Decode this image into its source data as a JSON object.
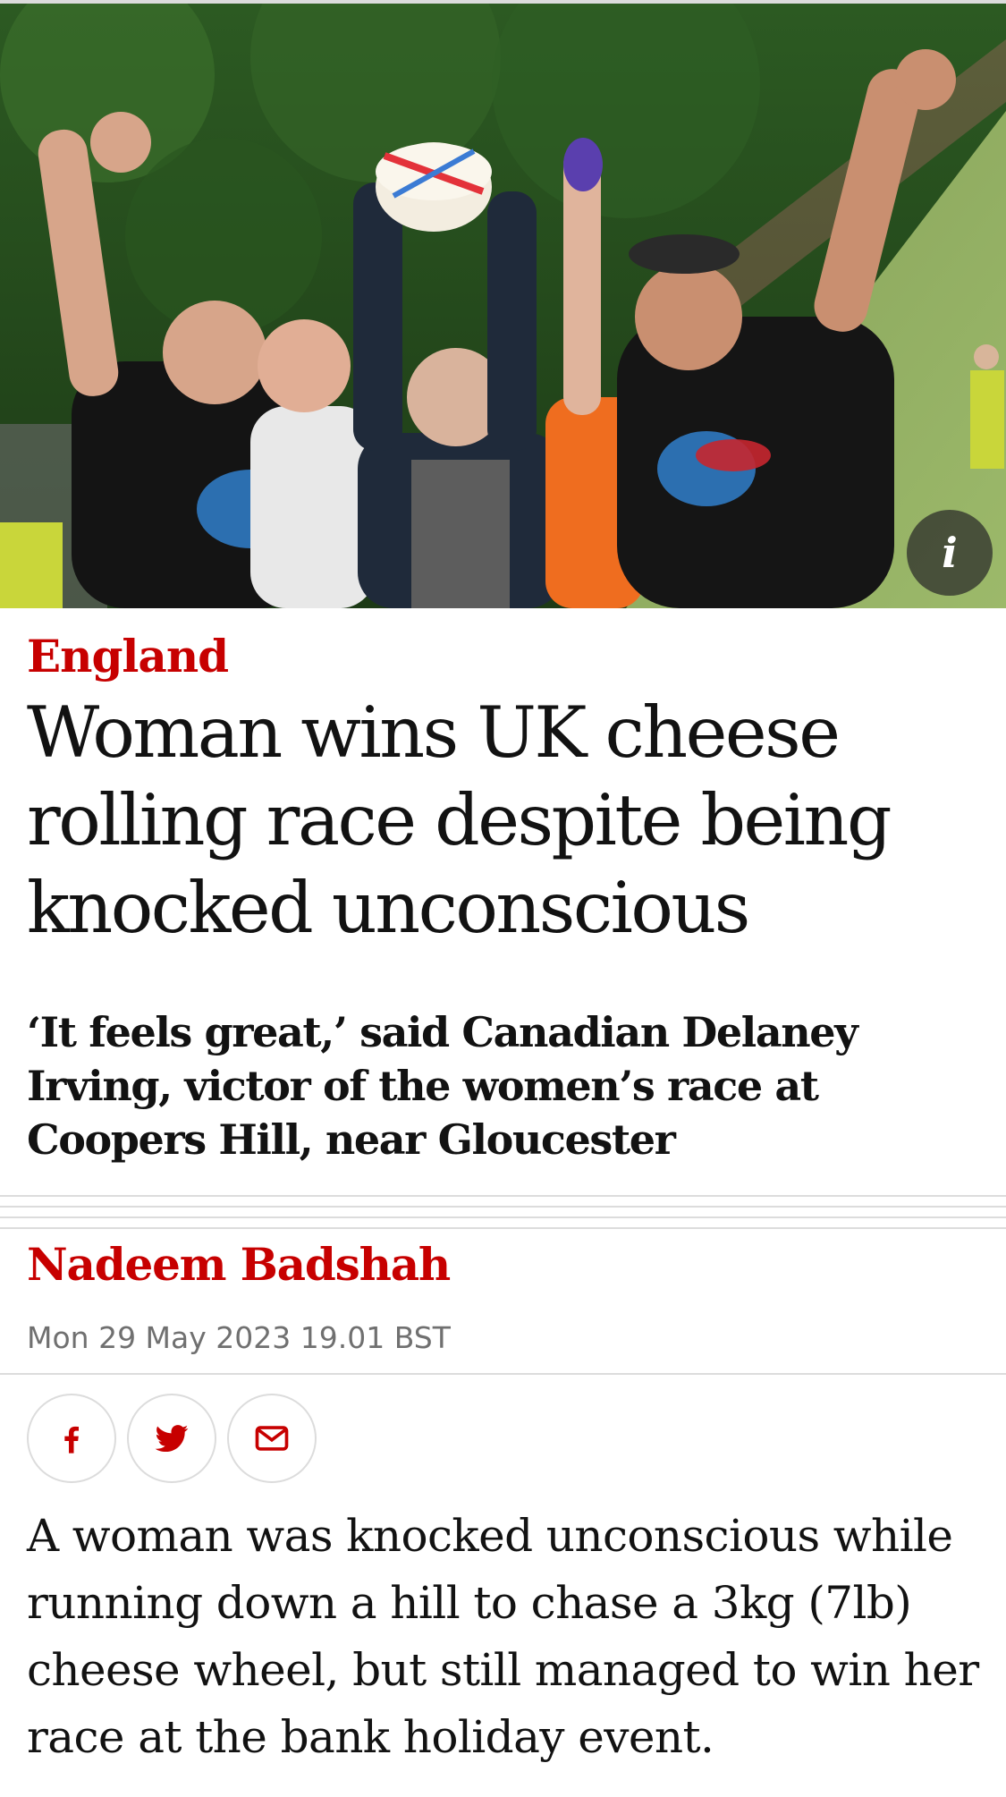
{
  "article": {
    "section": "England",
    "headline": "Woman wins UK cheese rolling race despite being knocked unconscious",
    "standfirst": "‘It feels great,’ said Canadian Delaney Irving, victor of the women’s race at Coopers Hill, near Gloucester",
    "author": "Nadeem Badshah",
    "date": "Mon 29 May 2023 19.01 BST",
    "body_first_paragraph": "A woman was knocked unconscious while running down a hill to chase a 3kg (7lb) cheese wheel, but still managed to win her race at the bank holiday event."
  },
  "hero_image": {
    "info_label": "i"
  },
  "share": {
    "buttons": [
      {
        "name": "facebook",
        "icon": "facebook-icon"
      },
      {
        "name": "twitter",
        "icon": "twitter-icon"
      },
      {
        "name": "email",
        "icon": "email-icon"
      }
    ]
  },
  "colors": {
    "accent": "#c70000",
    "text": "#121212",
    "muted": "#707070",
    "rule": "#dcdcdc"
  }
}
